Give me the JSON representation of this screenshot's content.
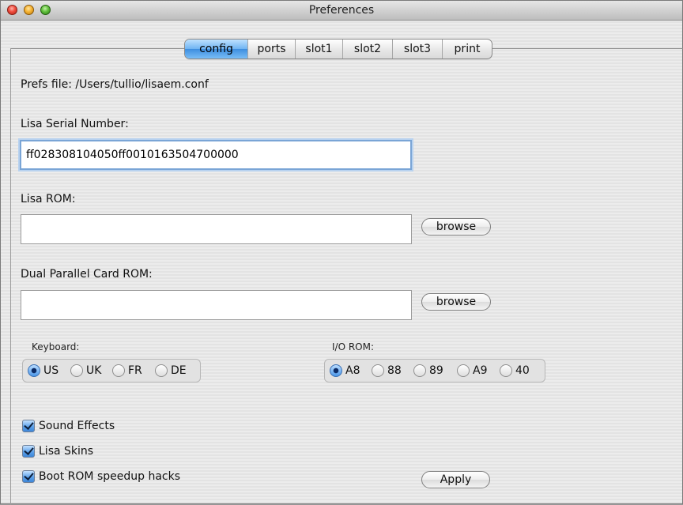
{
  "window": {
    "title": "Preferences"
  },
  "tabs": [
    {
      "label": "config",
      "active": true
    },
    {
      "label": "ports",
      "active": false
    },
    {
      "label": "slot1",
      "active": false
    },
    {
      "label": "slot2",
      "active": false
    },
    {
      "label": "slot3",
      "active": false
    },
    {
      "label": "print",
      "active": false
    }
  ],
  "config": {
    "prefs_file": "Prefs file: /Users/tullio/lisaem.conf",
    "serial_label": "Lisa Serial Number:",
    "serial_value": "ff028308104050ff0010163504700000",
    "rom_label": "Lisa ROM:",
    "rom_value": "",
    "rom_browse": "browse",
    "dpc_label": "Dual Parallel Card ROM:",
    "dpc_value": "",
    "dpc_browse": "browse",
    "keyboard": {
      "label": "Keyboard:",
      "options": [
        "US",
        "UK",
        "FR",
        "DE"
      ],
      "selected": "US"
    },
    "iorom": {
      "label": "I/O ROM:",
      "options": [
        "A8",
        "88",
        "89",
        "A9",
        "40"
      ],
      "selected": "A8"
    },
    "checkboxes": [
      {
        "label": "Sound Effects",
        "checked": true
      },
      {
        "label": "Lisa Skins",
        "checked": true
      },
      {
        "label": "Boot ROM speedup hacks",
        "checked": true
      }
    ],
    "apply": "Apply"
  },
  "colors": {
    "accent": "#4a97e8",
    "window_bg": "#ececec"
  }
}
